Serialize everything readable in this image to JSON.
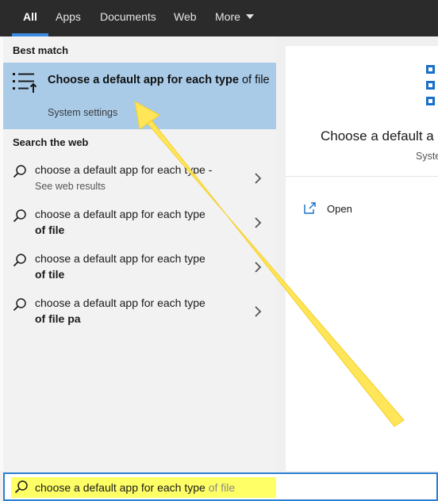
{
  "tabs": [
    {
      "label": "All",
      "active": true
    },
    {
      "label": "Apps",
      "active": false
    },
    {
      "label": "Documents",
      "active": false
    },
    {
      "label": "Web",
      "active": false
    },
    {
      "label": "More",
      "active": false
    }
  ],
  "best_match": {
    "heading": "Best match",
    "title_bold": "Choose a default app for each type",
    "title_rest": " of file",
    "subtitle": "System settings",
    "icon": "default-apps-list-icon"
  },
  "web": {
    "heading": "Search the web",
    "results": [
      {
        "line1": "choose a default app for each type -",
        "line2": "See web results",
        "muted": true
      },
      {
        "line1": "choose a default app for each type",
        "line2": "of file",
        "muted": false
      },
      {
        "line1": "choose a default app for each type",
        "line2": "of tile",
        "muted": false
      },
      {
        "line1": "choose a default app for each type",
        "line2": "of file pa",
        "muted": false
      }
    ]
  },
  "preview": {
    "title": "Choose a default a",
    "subtitle": "Syste",
    "actions": [
      {
        "label": "Open",
        "icon": "open-external-icon"
      }
    ]
  },
  "search": {
    "typed": "choose a default app for each type",
    "suggestion": " of file",
    "icon": "search-icon"
  },
  "colors": {
    "topbar": "#2b2b2b",
    "accent": "#3b8ae0",
    "best_match_bg": "#a9cbe8",
    "annotation_arrow": "#ffe558",
    "search_highlight": "#ffff66"
  }
}
